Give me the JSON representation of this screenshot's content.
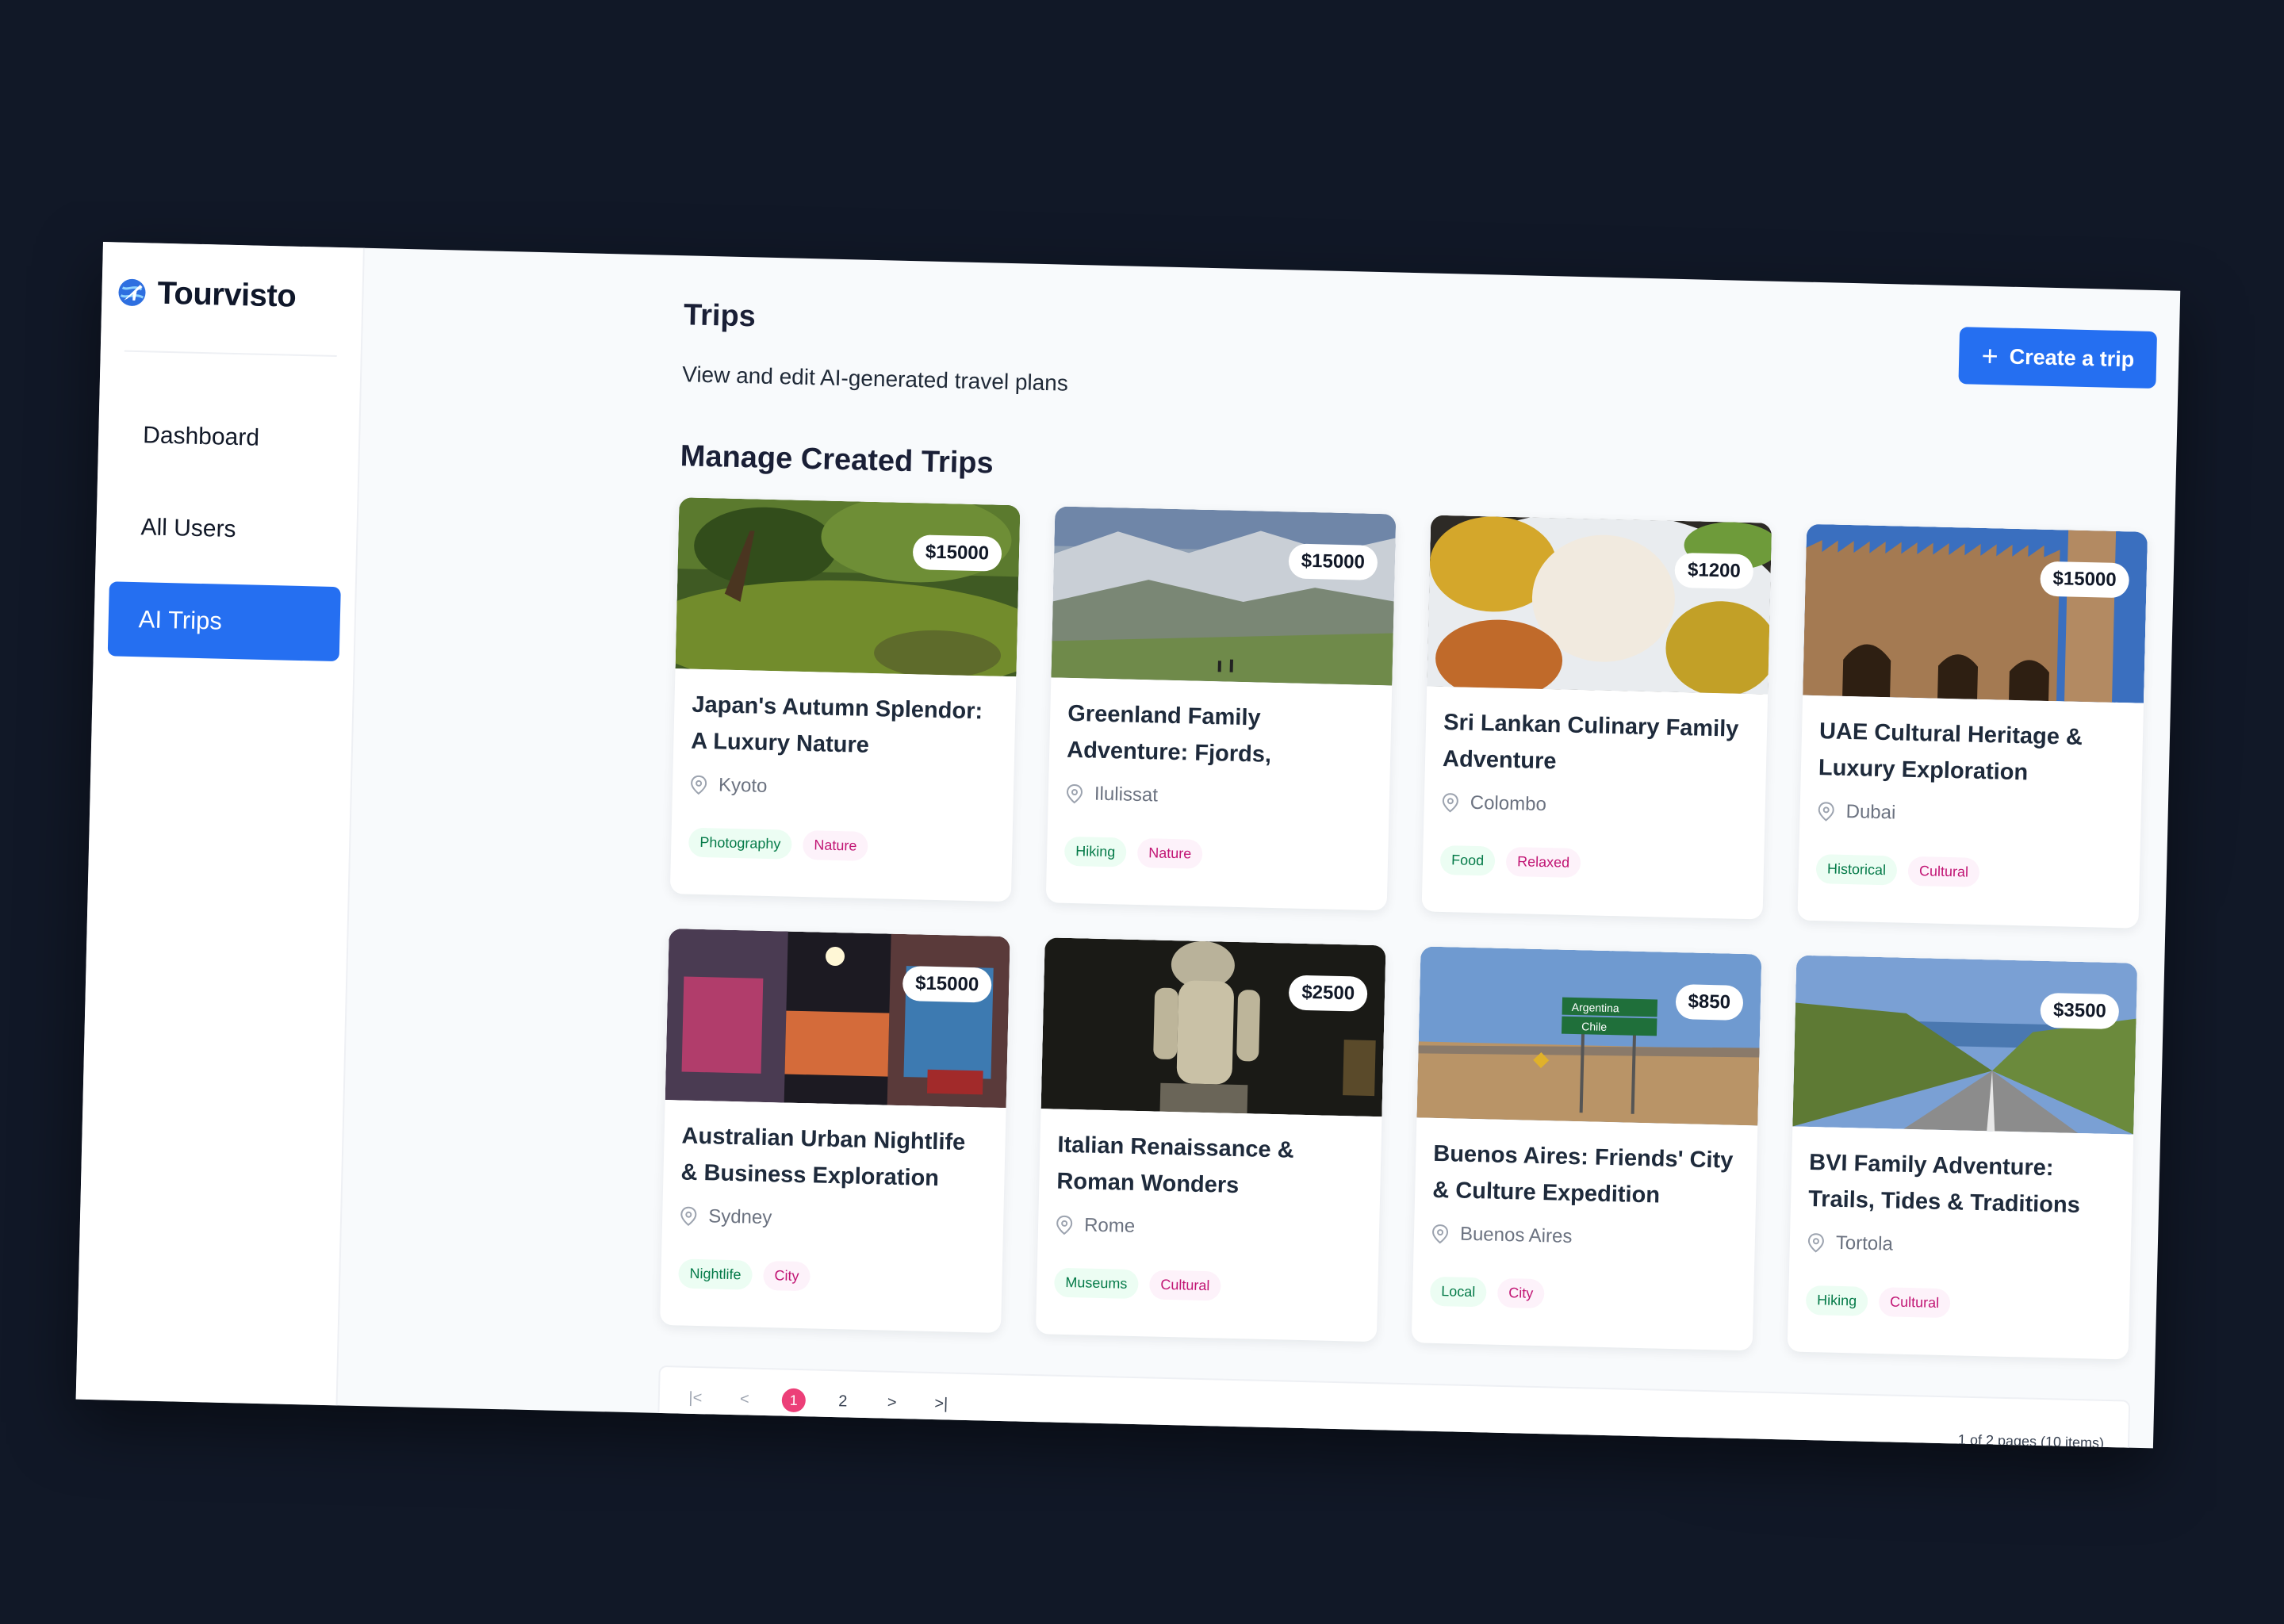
{
  "app": {
    "name": "Tourvisto"
  },
  "sidebar": {
    "items": [
      {
        "label": "Dashboard"
      },
      {
        "label": "All Users"
      },
      {
        "label": "AI Trips",
        "active": true
      }
    ]
  },
  "header": {
    "title": "Trips",
    "subtitle": "View and edit AI-generated travel plans",
    "create_label": "Create a trip"
  },
  "section_title": "Manage Created Trips",
  "trips": [
    {
      "title": "Japan's Autumn Splendor: A Luxury Nature Photograph...",
      "price": "$15000",
      "location": "Kyoto",
      "tags": [
        "Photography",
        "Nature"
      ]
    },
    {
      "title": "Greenland Family Adventure: Fjords, Glacier...",
      "price": "$15000",
      "location": "Ilulissat",
      "tags": [
        "Hiking",
        "Nature"
      ]
    },
    {
      "title": "Sri Lankan Culinary Family Adventure",
      "price": "$1200",
      "location": "Colombo",
      "tags": [
        "Food",
        "Relaxed"
      ]
    },
    {
      "title": "UAE Cultural Heritage & Luxury Exploration",
      "price": "$15000",
      "location": "Dubai",
      "tags": [
        "Historical",
        "Cultural"
      ]
    },
    {
      "title": "Australian Urban Nightlife & Business Exploration",
      "price": "$15000",
      "location": "Sydney",
      "tags": [
        "Nightlife",
        "City"
      ]
    },
    {
      "title": "Italian Renaissance & Roman Wonders",
      "price": "$2500",
      "location": "Rome",
      "tags": [
        "Museums",
        "Cultural"
      ]
    },
    {
      "title": "Buenos Aires: Friends' City & Culture Expedition",
      "price": "$850",
      "location": "Buenos Aires",
      "tags": [
        "Local",
        "City"
      ],
      "sign_labels": [
        "Argentina",
        "Chile"
      ]
    },
    {
      "title": "BVI Family Adventure: Trails, Tides & Traditions",
      "price": "$3500",
      "location": "Tortola",
      "tags": [
        "Hiking",
        "Cultural"
      ]
    }
  ],
  "pagination": {
    "pages": [
      "1",
      "2"
    ],
    "current": "1",
    "first": "|<",
    "prev": "<",
    "next": ">",
    "last": ">|",
    "info": "1 of 2 pages (10 items)"
  },
  "colors": {
    "accent": "#256ff1",
    "page_active": "#ec3f78",
    "tag_green": "#047a48",
    "tag_pink": "#c11574"
  },
  "icons": {
    "logo": "globe-plane-icon",
    "create": "plus-icon",
    "location": "location-pin-icon"
  }
}
